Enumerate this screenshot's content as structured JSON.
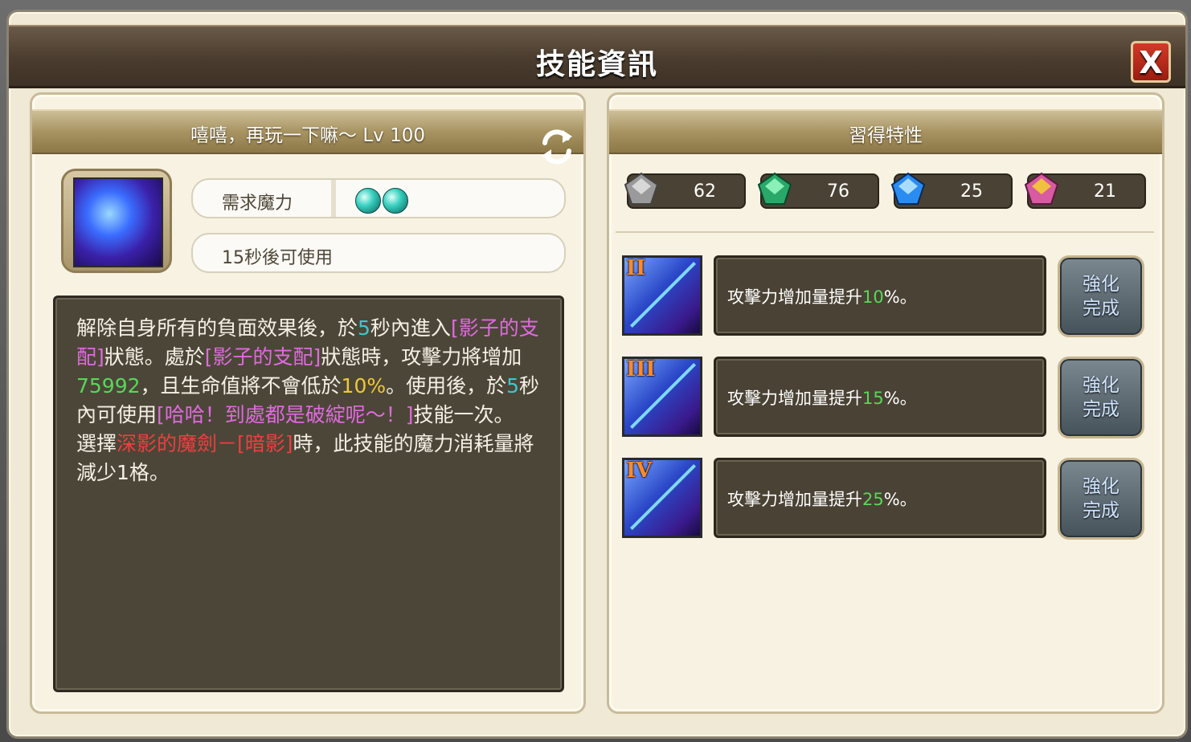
{
  "window": {
    "title": "技能資訊",
    "close_label": "X"
  },
  "skill": {
    "header": "嘻嘻，再玩一下嘛～ Lv  100",
    "mana_label": "需求魔力",
    "mana_orbs": 2,
    "cooldown_text": "15秒後可使用",
    "description": [
      [
        {
          "t": "解除自身所有的負面效果後，於",
          "c": ""
        },
        {
          "t": "5",
          "c": "c"
        },
        {
          "t": "秒內進入",
          "c": ""
        },
        {
          "t": "[影子的支配]",
          "c": "p"
        },
        {
          "t": "狀態。處於",
          "c": ""
        },
        {
          "t": "[影子的支配]",
          "c": "p"
        },
        {
          "t": "狀態時，攻擊力將增加",
          "c": ""
        },
        {
          "t": "75992",
          "c": "g"
        },
        {
          "t": "，且生命值將不會低於",
          "c": ""
        },
        {
          "t": "10%",
          "c": "y"
        },
        {
          "t": "。使用後，於",
          "c": ""
        },
        {
          "t": "5",
          "c": "c"
        },
        {
          "t": "秒內可使用",
          "c": ""
        },
        {
          "t": "[哈哈！到處都是破綻呢～！]",
          "c": "p"
        },
        {
          "t": "技能一次。",
          "c": ""
        }
      ],
      [
        {
          "t": "選擇",
          "c": ""
        },
        {
          "t": "深影的魔劍－",
          "c": "r"
        },
        {
          "t": "[暗影]",
          "c": "r"
        },
        {
          "t": "時，此技能的魔力消耗量將減少1格。",
          "c": ""
        }
      ]
    ]
  },
  "traits": {
    "header": "習得特性",
    "stats": [
      {
        "icon": "gray-gem-icon",
        "value": "62",
        "color": "#9a9a9a"
      },
      {
        "icon": "green-gem-icon",
        "value": "76",
        "color": "#2aa86a"
      },
      {
        "icon": "blue-gem-icon",
        "value": "25",
        "color": "#2a8cf0"
      },
      {
        "icon": "rainbow-gem-icon",
        "value": "21",
        "color": "#d85aa0"
      }
    ],
    "rows": [
      {
        "rank": "II",
        "prefix": "攻擊力增加量提升",
        "value": "10",
        "suffix": "%。",
        "button": "強化完成"
      },
      {
        "rank": "III",
        "prefix": "攻擊力增加量提升",
        "value": "15",
        "suffix": "%。",
        "button": "強化完成"
      },
      {
        "rank": "IV",
        "prefix": "攻擊力增加量提升",
        "value": "25",
        "suffix": "%。",
        "button": "強化完成"
      }
    ]
  }
}
